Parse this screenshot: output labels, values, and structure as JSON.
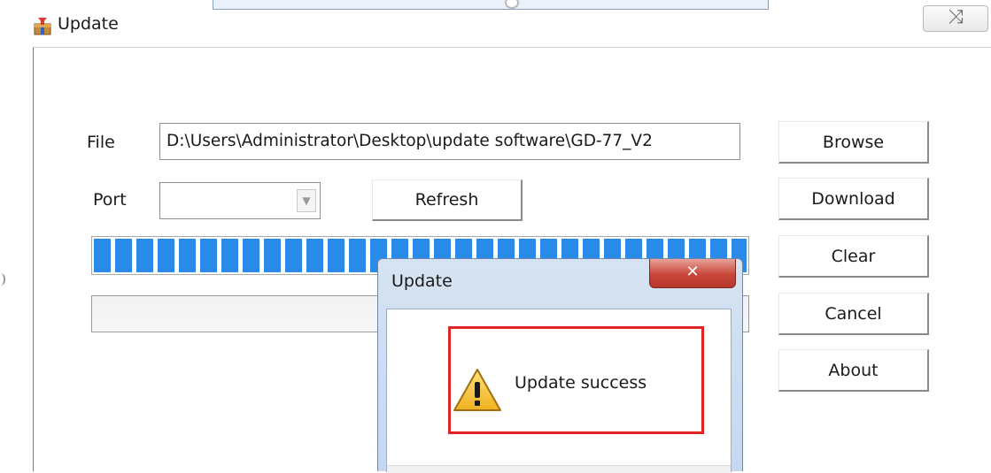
{
  "window": {
    "title": "Update",
    "close_glyph": "⤨"
  },
  "form": {
    "file_label": "File",
    "file_path": "D:\\Users\\Administrator\\Desktop\\update software\\GD-77_V2",
    "port_label": "Port",
    "port_value": "",
    "dropdown_glyph": "▼",
    "refresh_label": "Refresh",
    "progress_fraction": 1.0,
    "status_text": ""
  },
  "buttons": {
    "browse": "Browse",
    "download": "Download",
    "clear": "Clear",
    "cancel": "Cancel",
    "about": "About"
  },
  "dialog": {
    "title": "Update",
    "close_glyph": "✕",
    "message": "Update success"
  },
  "icons": {
    "app": "app-package-icon",
    "warning": "warning-icon",
    "dropdown": "chevron-down-icon",
    "close": "close-icon"
  },
  "colors": {
    "progress": "#2a8ae8",
    "highlight": "#e02424",
    "dialog_close": "#c9473a"
  }
}
